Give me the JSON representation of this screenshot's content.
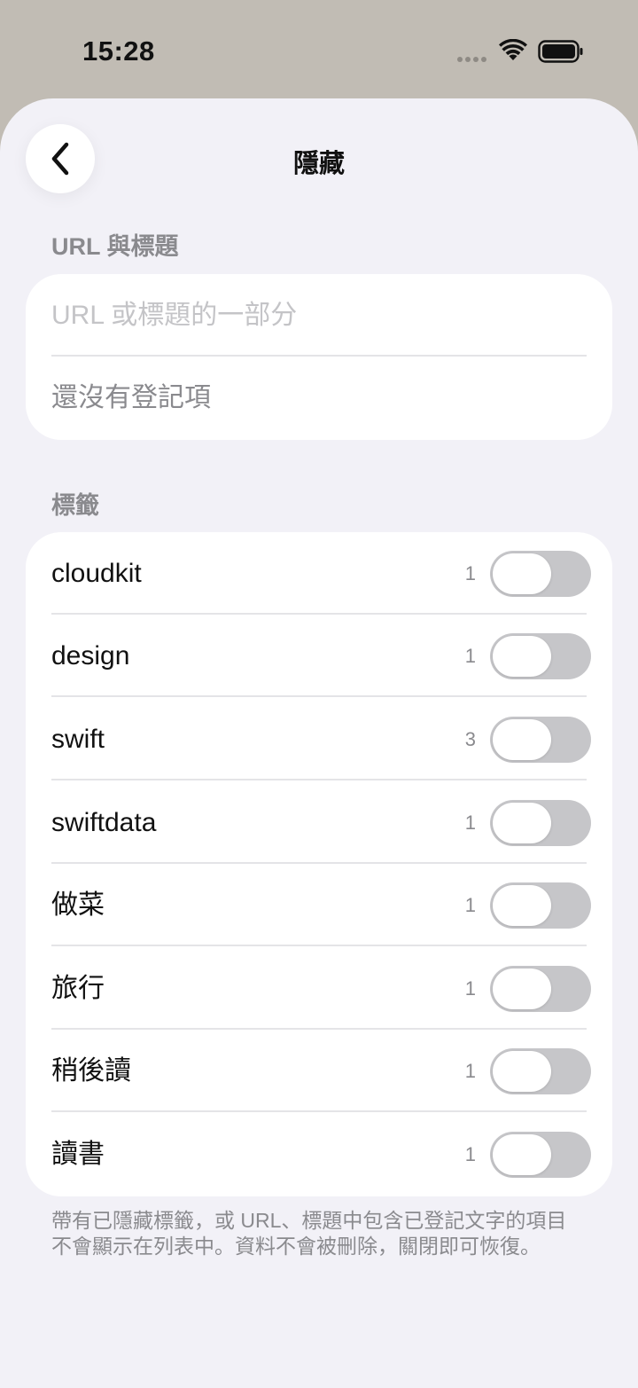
{
  "status_bar": {
    "time": "15:28"
  },
  "nav": {
    "title": "隱藏"
  },
  "url_section": {
    "header": "URL 與標題",
    "input_placeholder": "URL 或標題的一部分",
    "input_value": "",
    "empty_text": "還沒有登記項"
  },
  "tags_section": {
    "header": "標籤",
    "items": [
      {
        "label": "cloudkit",
        "count": "1",
        "hidden": false
      },
      {
        "label": "design",
        "count": "1",
        "hidden": false
      },
      {
        "label": "swift",
        "count": "3",
        "hidden": false
      },
      {
        "label": "swiftdata",
        "count": "1",
        "hidden": false
      },
      {
        "label": "做菜",
        "count": "1",
        "hidden": false
      },
      {
        "label": "旅行",
        "count": "1",
        "hidden": false
      },
      {
        "label": "稍後讀",
        "count": "1",
        "hidden": false
      },
      {
        "label": "讀書",
        "count": "1",
        "hidden": false
      }
    ]
  },
  "footer": {
    "line1": "帶有已隱藏標籤，或 URL、標題中包含已登記文字的項目",
    "line2": "不會顯示在列表中。資料不會被刪除，關閉即可恢復。"
  }
}
